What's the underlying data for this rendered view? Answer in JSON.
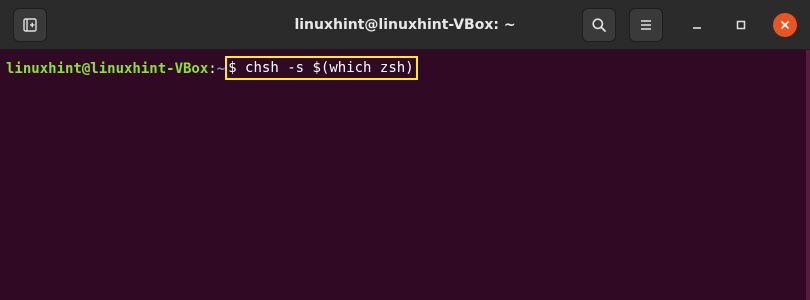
{
  "window": {
    "title": "linuxhint@linuxhint-VBox: ~"
  },
  "titlebar": {
    "icons": {
      "new_tab": "new-tab-icon",
      "search": "search-icon",
      "menu": "hamburger-menu-icon",
      "minimize": "minimize-icon",
      "maximize": "maximize-icon",
      "close": "close-icon"
    }
  },
  "terminal": {
    "prompt_user_host": "linuxhint@linuxhint-VBox",
    "prompt_sep": ":",
    "prompt_cwd": "~",
    "prompt_symbol": "$",
    "command": "chsh -s $(which zsh)"
  },
  "colors": {
    "titlebar_bg": "#2b2b2b",
    "terminal_bg": "#300a24",
    "prompt_user_color": "#8ae234",
    "prompt_cwd_color": "#729fcf",
    "highlight_border": "#ffee00",
    "close_button": "#e95420"
  }
}
